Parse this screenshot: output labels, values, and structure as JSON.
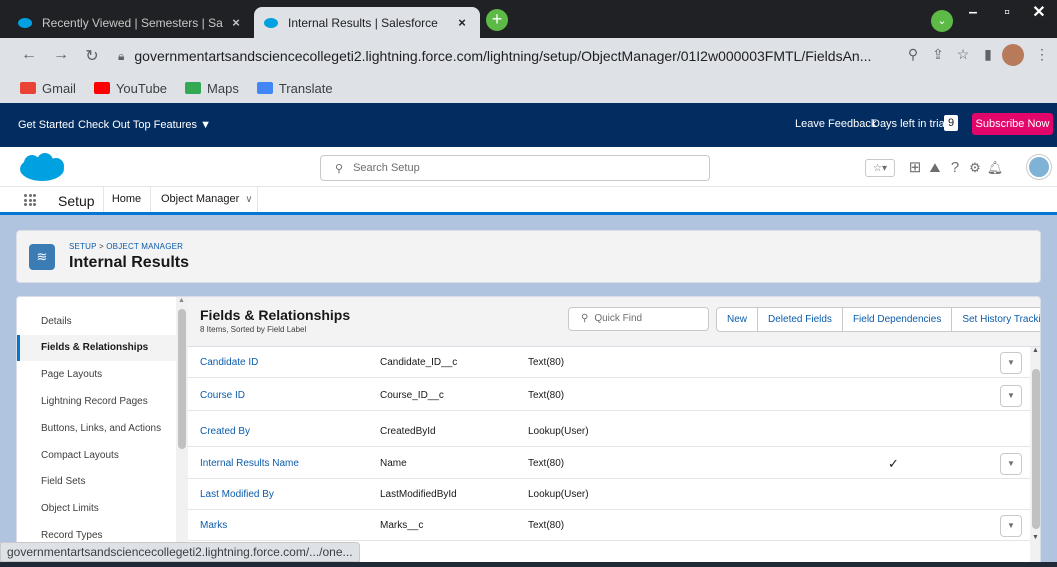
{
  "browser": {
    "tabs": [
      {
        "title": "Recently Viewed | Semesters | Sa",
        "close": "×"
      },
      {
        "title": "Internal Results | Salesforce",
        "close": "×"
      }
    ],
    "new_tab": "+",
    "url": "governmentartsandsciencecollegeti2.lightning.force.com/lightning/setup/ObjectManager/01I2w000003FMTL/FieldsAn...",
    "bookmarks": [
      {
        "label": "Gmail",
        "icon": "gmail-icon",
        "color": "#ea4335"
      },
      {
        "label": "YouTube",
        "icon": "youtube-icon",
        "color": "#ff0000"
      },
      {
        "label": "Maps",
        "icon": "maps-icon",
        "color": "#34a853"
      },
      {
        "label": "Translate",
        "icon": "translate-icon",
        "color": "#4285f4"
      }
    ],
    "status_url": "governmentartsandsciencecollegeti2.lightning.force.com/.../one..."
  },
  "trial_bar": {
    "get_started": "Get Started",
    "top_features": "Check Out Top Features ▼",
    "leave_feedback": "Leave Feedback",
    "days_left_label": "Days left in trial",
    "days_left": "9",
    "subscribe": "Subscribe Now"
  },
  "header": {
    "search_placeholder": "Search Setup",
    "brand_color": "#00a1e0"
  },
  "setup_nav": {
    "app": "Setup",
    "tabs": [
      "Home",
      "Object Manager"
    ]
  },
  "object": {
    "breadcrumb_setup": "SETUP",
    "breadcrumb_sep": " > ",
    "breadcrumb_om": "OBJECT MANAGER",
    "name": "Internal Results"
  },
  "left_nav": {
    "items": [
      "Details",
      "Fields & Relationships",
      "Page Layouts",
      "Lightning Record Pages",
      "Buttons, Links, and Actions",
      "Compact Layouts",
      "Field Sets",
      "Object Limits",
      "Record Types"
    ],
    "active": "Fields & Relationships"
  },
  "fields": {
    "title": "Fields & Relationships",
    "subtitle": "8 Items, Sorted by Field Label",
    "quick_find_placeholder": "Quick Find",
    "buttons": [
      "New",
      "Deleted Fields",
      "Field Dependencies",
      "Set History Tracking"
    ],
    "rows": [
      {
        "label": "Candidate ID",
        "api": "Candidate_ID__c",
        "type": "Text(80)",
        "indexed": "",
        "menu": "▼"
      },
      {
        "label": "Course ID",
        "api": "Course_ID__c",
        "type": "Text(80)",
        "indexed": "",
        "menu": "▼"
      },
      {
        "label": "Created By",
        "api": "CreatedById",
        "type": "Lookup(User)",
        "indexed": "",
        "menu": ""
      },
      {
        "label": "Internal Results Name",
        "api": "Name",
        "type": "Text(80)",
        "indexed": "✓",
        "menu": "▼"
      },
      {
        "label": "Last Modified By",
        "api": "LastModifiedById",
        "type": "Lookup(User)",
        "indexed": "",
        "menu": ""
      },
      {
        "label": "Marks",
        "api": "Marks__c",
        "type": "Text(80)",
        "indexed": "",
        "menu": "▼"
      }
    ]
  }
}
